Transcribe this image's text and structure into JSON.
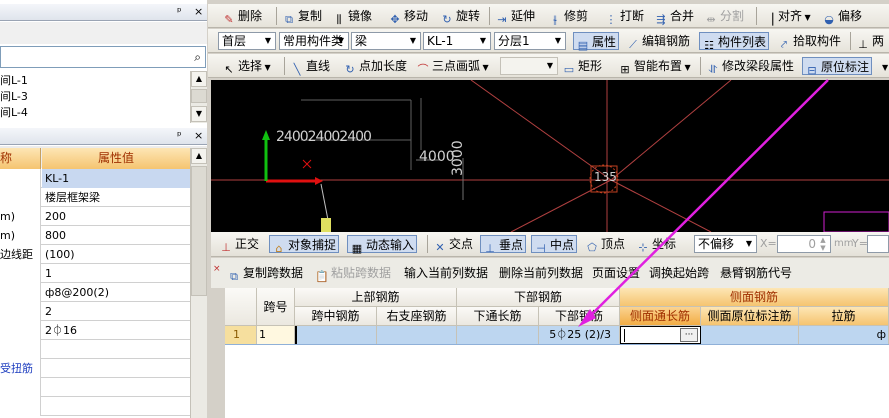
{
  "left_panel": {
    "top_title_pin": "ᵖ",
    "top_title_close": "×",
    "list_items": [
      "间L-1",
      "间L-3",
      "间L-4"
    ],
    "props_title_pin": "ᵖ",
    "props_title_close": "×",
    "col_name": "称",
    "col_value": "属性值",
    "rows": [
      {
        "name": "",
        "value": "KL-1"
      },
      {
        "name": "",
        "value": "楼层框架梁"
      },
      {
        "name": "m)",
        "value": "200"
      },
      {
        "name": "m)",
        "value": "800"
      },
      {
        "name": "边线距",
        "value": "(100)"
      },
      {
        "name": "",
        "value": "1"
      },
      {
        "name": "",
        "value": "ф8@200(2)"
      },
      {
        "name": "",
        "value": "2"
      },
      {
        "name": "",
        "value": "2⏀16"
      },
      {
        "name": "",
        "value": ""
      },
      {
        "name": "受扭筋",
        "value": ""
      },
      {
        "name": "",
        "value": ""
      },
      {
        "name": "",
        "value": ""
      }
    ]
  },
  "toolbar1": {
    "items": [
      "删除",
      "复制",
      "镜像",
      "移动",
      "旋转",
      "延伸",
      "修剪",
      "打断",
      "合并",
      "分割",
      "对齐",
      "偏移"
    ]
  },
  "toolbar2": {
    "floor": "首层",
    "category": "常用构件类",
    "type": "梁",
    "element": "KL-1",
    "layer": "分层1",
    "btn_props": "属性",
    "btn_edit_rebar": "编辑钢筋",
    "btn_element_list": "构件列表",
    "btn_pick": "拾取构件",
    "btn_more": "两"
  },
  "toolbar3": {
    "select": "选择",
    "line": "直线",
    "point_len": "点加长度",
    "arc3": "三点画弧",
    "rect": "矩形",
    "smart_layout": "智能布置",
    "modify_segment": "修改梁段属性",
    "in_situ": "原位标注"
  },
  "canvas": {
    "dims": [
      "2400",
      "2400",
      "2400",
      "4000",
      "3000",
      "135"
    ]
  },
  "status": {
    "ortho": "正交",
    "snap": "对象捕捉",
    "dyn_input": "动态输入",
    "intersect": "交点",
    "perp": "垂点",
    "mid": "中点",
    "vertex": "顶点",
    "coord": "坐标",
    "offset": "不偏移",
    "x_label": "X=",
    "x_value": "0",
    "mm": "mm",
    "y_label": "Y="
  },
  "grid_toolbar": {
    "items": [
      "复制跨数据",
      "粘贴跨数据",
      "输入当前列数据",
      "删除当前列数据",
      "页面设置",
      "调换起始跨",
      "悬臂钢筋代号"
    ]
  },
  "grid": {
    "span_no": "跨号",
    "top_rebar": "上部钢筋",
    "bottom_rebar": "下部钢筋",
    "side_rebar": "侧面钢筋",
    "cols": [
      "跨中钢筋",
      "右支座钢筋",
      "下通长筋",
      "下部钢筋",
      "侧面通长筋",
      "侧面原位标注筋",
      "拉筋"
    ],
    "row": {
      "index": "1",
      "span": "1",
      "bottom": "5⏀25 (2)/3",
      "edit_btn": "···",
      "tail": "ф"
    }
  },
  "colors": {
    "canvas_bg": "#000000",
    "magenta": "#e020e0",
    "side_header": "#f5c470"
  }
}
